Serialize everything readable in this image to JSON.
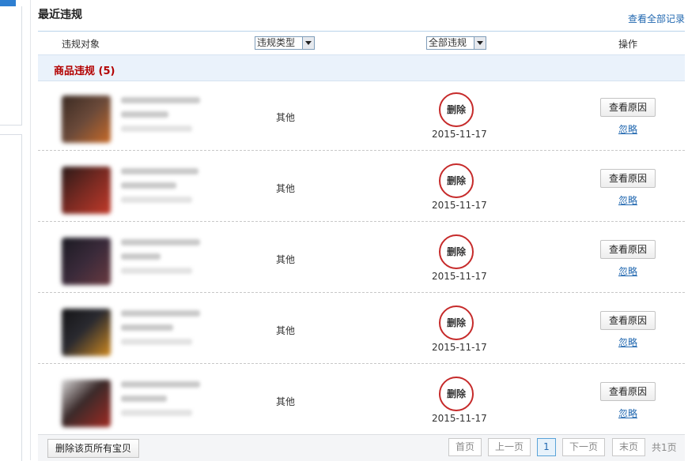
{
  "header": {
    "title": "最近违规",
    "view_all": "查看全部记录"
  },
  "columns": {
    "target": "违规对象",
    "type_select": "违规类型",
    "status_select": "全部违规",
    "operation": "操作"
  },
  "section": {
    "title": "商品违规 (5)"
  },
  "rows": [
    {
      "type": "其他",
      "stamp": "删除",
      "date": "2015-11-17",
      "reason_button": "查看原因",
      "ignore_link": "忽略"
    },
    {
      "type": "其他",
      "stamp": "删除",
      "date": "2015-11-17",
      "reason_button": "查看原因",
      "ignore_link": "忽略"
    },
    {
      "type": "其他",
      "stamp": "删除",
      "date": "2015-11-17",
      "reason_button": "查看原因",
      "ignore_link": "忽略"
    },
    {
      "type": "其他",
      "stamp": "删除",
      "date": "2015-11-17",
      "reason_button": "查看原因",
      "ignore_link": "忽略"
    },
    {
      "type": "其他",
      "stamp": "删除",
      "date": "2015-11-17",
      "reason_button": "查看原因",
      "ignore_link": "忽略"
    }
  ],
  "footer": {
    "delete_all": "删除该页所有宝贝",
    "first": "首页",
    "prev": "上一页",
    "current_page": "1",
    "next": "下一页",
    "last": "末页",
    "total": "共1页"
  },
  "colors": {
    "stamp_red": "#c62a2a",
    "link_blue": "#2268b0",
    "section_bg": "#eaf2fb",
    "section_text": "#b30000"
  }
}
